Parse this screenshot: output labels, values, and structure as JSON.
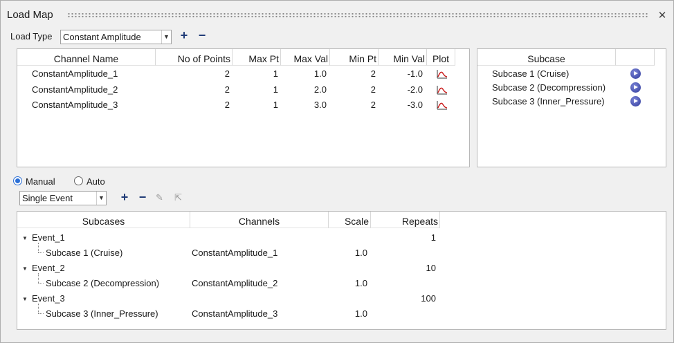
{
  "window": {
    "title": "Load Map"
  },
  "load_type": {
    "label": "Load Type",
    "value": "Constant Amplitude"
  },
  "channels_table": {
    "headers": [
      "Channel Name",
      "No of Points",
      "Max Pt",
      "Max Val",
      "Min Pt",
      "Min Val",
      "Plot"
    ],
    "rows": [
      {
        "name": "ConstantAmplitude_1",
        "points": "2",
        "max_pt": "1",
        "max_val": "1.0",
        "min_pt": "2",
        "min_val": "-1.0"
      },
      {
        "name": "ConstantAmplitude_2",
        "points": "2",
        "max_pt": "1",
        "max_val": "2.0",
        "min_pt": "2",
        "min_val": "-2.0"
      },
      {
        "name": "ConstantAmplitude_3",
        "points": "2",
        "max_pt": "1",
        "max_val": "3.0",
        "min_pt": "2",
        "min_val": "-3.0"
      }
    ]
  },
  "subcase_table": {
    "header": "Subcase",
    "rows": [
      "Subcase 1 (Cruise)",
      "Subcase 2 (Decompression)",
      "Subcase 3 (Inner_Pressure)"
    ]
  },
  "mode": {
    "manual": "Manual",
    "auto": "Auto",
    "selected": "Manual"
  },
  "event_type": {
    "value": "Single Event"
  },
  "events_table": {
    "headers": [
      "Subcases",
      "Channels",
      "Scale",
      "Repeats"
    ],
    "events": [
      {
        "name": "Event_1",
        "repeats": "1",
        "subcase": "Subcase 1 (Cruise)",
        "channel": "ConstantAmplitude_1",
        "scale": "1.0"
      },
      {
        "name": "Event_2",
        "repeats": "10",
        "subcase": "Subcase 2 (Decompression)",
        "channel": "ConstantAmplitude_2",
        "scale": "1.0"
      },
      {
        "name": "Event_3",
        "repeats": "100",
        "subcase": "Subcase 3 (Inner_Pressure)",
        "channel": "ConstantAmplitude_3",
        "scale": "1.0"
      }
    ]
  },
  "icons": {
    "close": "close-icon",
    "add": "plus-icon",
    "remove": "minus-icon",
    "plot": "curve-plot-icon",
    "play": "play-icon"
  },
  "colors": {
    "accent": "#2b6fd6",
    "toolbar_icon": "#1f3b77",
    "plot_curve": "#cc2222"
  }
}
